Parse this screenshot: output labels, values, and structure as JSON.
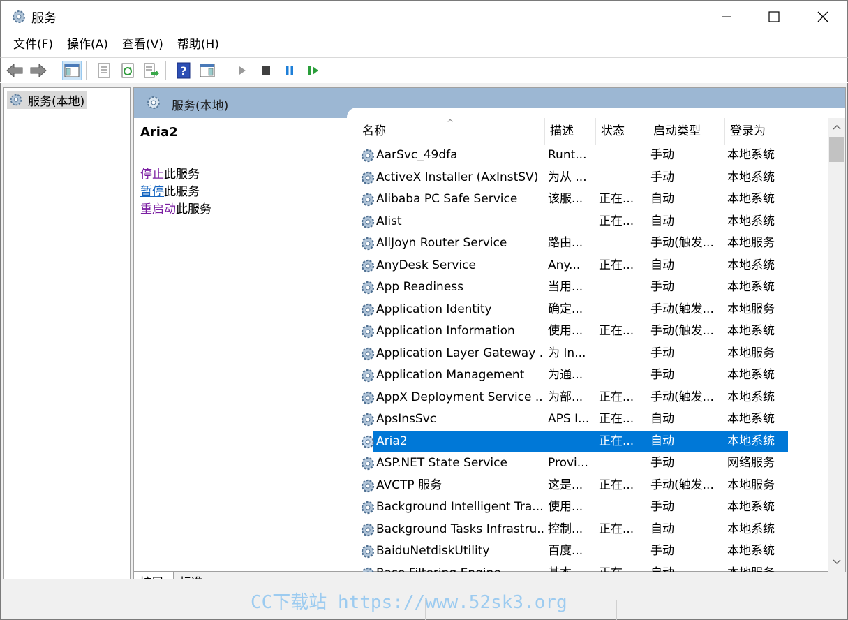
{
  "window": {
    "title": "服务"
  },
  "menu": [
    "文件(F)",
    "操作(A)",
    "查看(V)",
    "帮助(H)"
  ],
  "toolbar": {
    "buttons": [
      "back-icon",
      "forward-icon",
      "show-hide-console-tree-icon",
      "properties-icon",
      "refresh-icon",
      "export-list-icon",
      "help-icon",
      "action-pane-icon",
      "start-service-icon",
      "stop-service-icon",
      "pause-service-icon",
      "resume-service-icon"
    ]
  },
  "tree": {
    "root_label": "服务(本地)"
  },
  "pane": {
    "header_title": "服务(本地)",
    "selected_service": "Aria2",
    "actions": [
      {
        "link": "停止",
        "suffix": "此服务"
      },
      {
        "link": "暂停",
        "suffix": "此服务"
      },
      {
        "link": "重启动",
        "suffix": "此服务"
      }
    ]
  },
  "columns": [
    "名称",
    "描述",
    "状态",
    "启动类型",
    "登录为"
  ],
  "services": [
    {
      "name": "AarSvc_49dfa",
      "desc": "Runt...",
      "status": "",
      "startup": "手动",
      "logon": "本地系统"
    },
    {
      "name": "ActiveX Installer (AxInstSV)",
      "desc": "为从 ...",
      "status": "",
      "startup": "手动",
      "logon": "本地系统"
    },
    {
      "name": "Alibaba PC Safe Service",
      "desc": "该服...",
      "status": "正在...",
      "startup": "自动",
      "logon": "本地系统"
    },
    {
      "name": "Alist",
      "desc": "",
      "status": "正在...",
      "startup": "自动",
      "logon": "本地系统"
    },
    {
      "name": "AllJoyn Router Service",
      "desc": "路由...",
      "status": "",
      "startup": "手动(触发...",
      "logon": "本地服务"
    },
    {
      "name": "AnyDesk Service",
      "desc": "Any...",
      "status": "正在...",
      "startup": "自动",
      "logon": "本地系统"
    },
    {
      "name": "App Readiness",
      "desc": "当用...",
      "status": "",
      "startup": "手动",
      "logon": "本地系统"
    },
    {
      "name": "Application Identity",
      "desc": "确定...",
      "status": "",
      "startup": "手动(触发...",
      "logon": "本地服务"
    },
    {
      "name": "Application Information",
      "desc": "使用...",
      "status": "正在...",
      "startup": "手动(触发...",
      "logon": "本地系统"
    },
    {
      "name": "Application Layer Gateway ...",
      "desc": "为 In...",
      "status": "",
      "startup": "手动",
      "logon": "本地服务"
    },
    {
      "name": "Application Management",
      "desc": "为通...",
      "status": "",
      "startup": "手动",
      "logon": "本地系统"
    },
    {
      "name": "AppX Deployment Service ...",
      "desc": "为部...",
      "status": "正在...",
      "startup": "手动(触发...",
      "logon": "本地系统"
    },
    {
      "name": "ApsInsSvc",
      "desc": "APS I...",
      "status": "正在...",
      "startup": "自动",
      "logon": "本地系统"
    },
    {
      "name": "Aria2",
      "desc": "",
      "status": "正在...",
      "startup": "自动",
      "logon": "本地系统"
    },
    {
      "name": "ASP.NET State Service",
      "desc": "Provi...",
      "status": "",
      "startup": "手动",
      "logon": "网络服务"
    },
    {
      "name": "AVCTP 服务",
      "desc": "这是...",
      "status": "正在...",
      "startup": "手动(触发...",
      "logon": "本地服务"
    },
    {
      "name": "Background Intelligent Tra...",
      "desc": "使用...",
      "status": "",
      "startup": "手动",
      "logon": "本地系统"
    },
    {
      "name": "Background Tasks Infrastru...",
      "desc": "控制...",
      "status": "正在...",
      "startup": "自动",
      "logon": "本地系统"
    },
    {
      "name": "BaiduNetdiskUtility",
      "desc": "百度...",
      "status": "",
      "startup": "手动",
      "logon": "本地系统"
    },
    {
      "name": "Base Filtering Engine",
      "desc": "基本...",
      "status": "正在...",
      "startup": "自动",
      "logon": "本地服务"
    }
  ],
  "selected_index": 13,
  "bottom_tabs": [
    "扩展",
    "标准"
  ],
  "watermark": "CC下载站 https://www.52sk3.org",
  "colors": {
    "selection": "#0078d7",
    "header_band": "#9cb7d3",
    "visited_link": "#7b1fa2",
    "link": "#1565c0"
  }
}
